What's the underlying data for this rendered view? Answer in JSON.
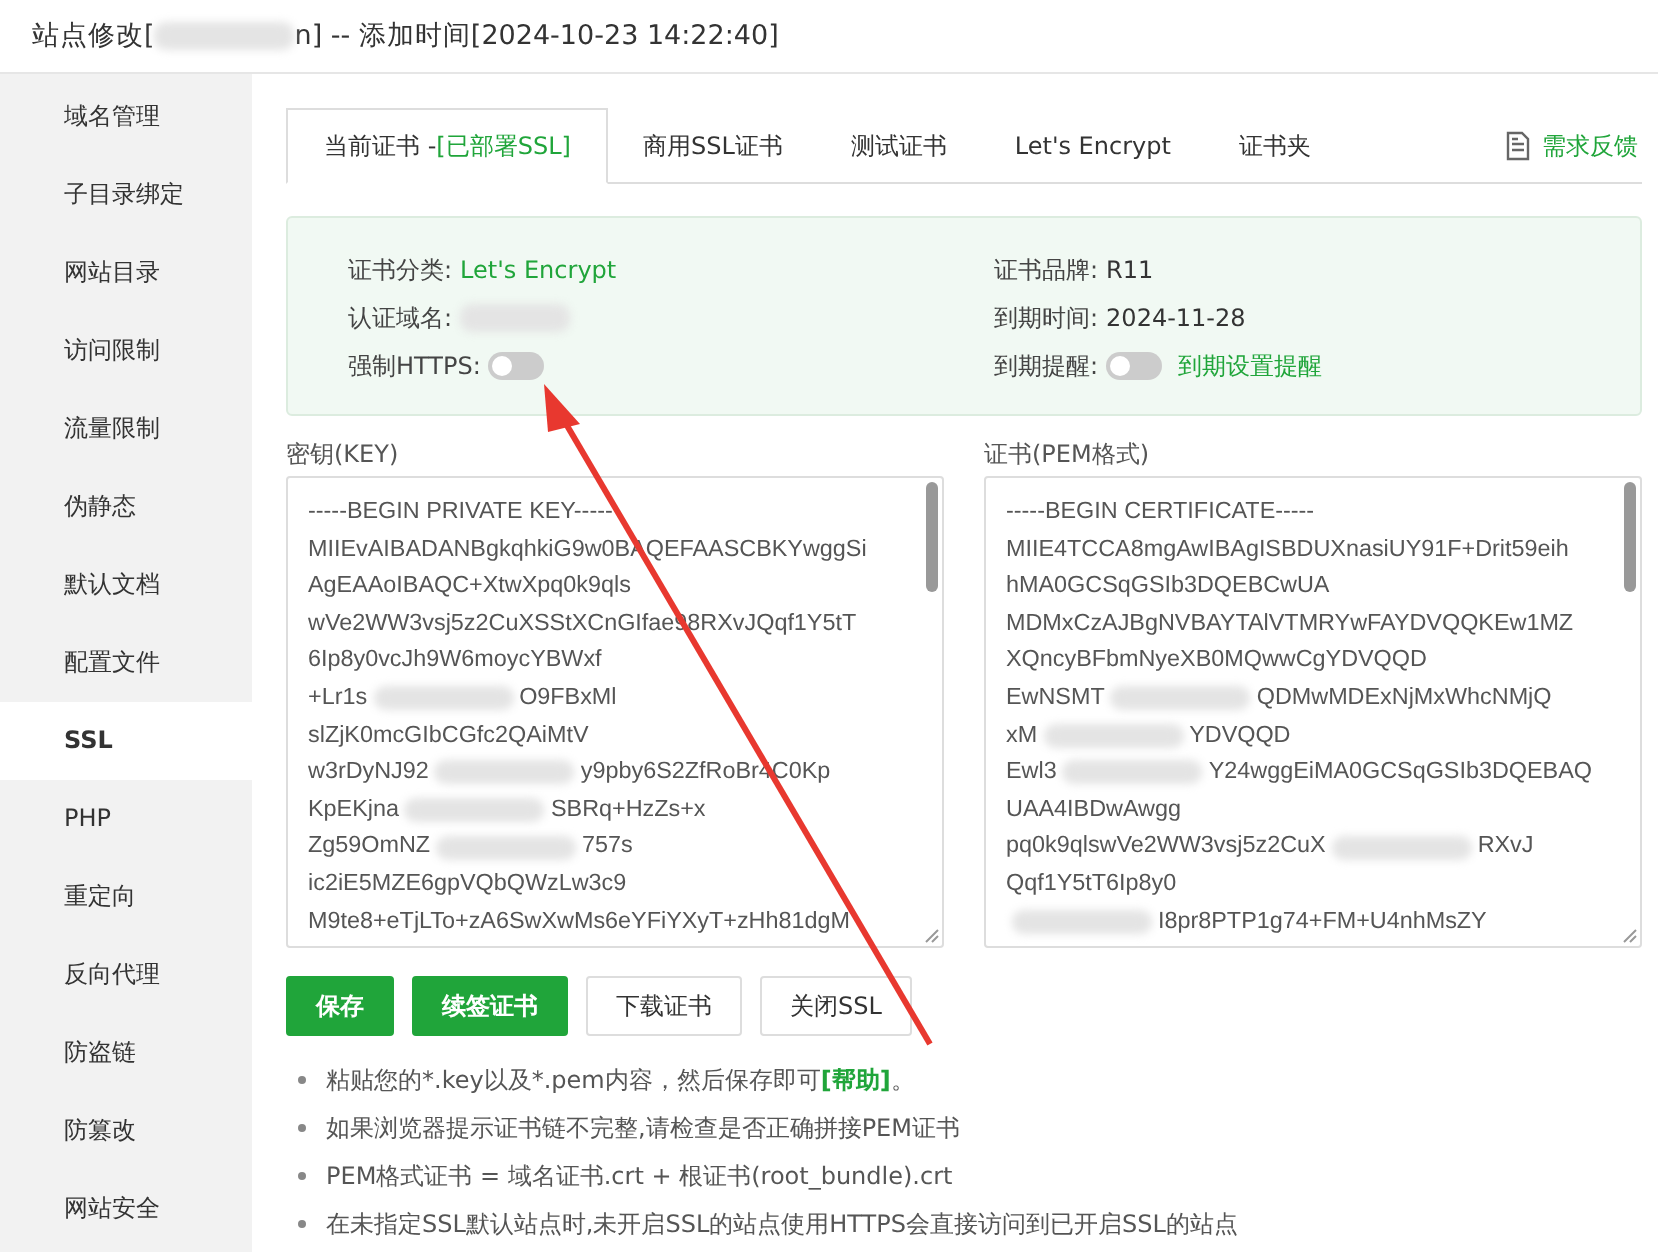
{
  "window": {
    "title_prefix": "站点修改[",
    "title_suffix": "n] -- 添加时间[2024-10-23 14:22:40]"
  },
  "sidebar": {
    "items": [
      {
        "label": "域名管理",
        "selected": false
      },
      {
        "label": "子目录绑定",
        "selected": false
      },
      {
        "label": "网站目录",
        "selected": false
      },
      {
        "label": "访问限制",
        "selected": false
      },
      {
        "label": "流量限制",
        "selected": false
      },
      {
        "label": "伪静态",
        "selected": false
      },
      {
        "label": "默认文档",
        "selected": false
      },
      {
        "label": "配置文件",
        "selected": false
      },
      {
        "label": "SSL",
        "selected": true
      },
      {
        "label": "PHP",
        "selected": false
      },
      {
        "label": "重定向",
        "selected": false
      },
      {
        "label": "反向代理",
        "selected": false
      },
      {
        "label": "防盗链",
        "selected": false
      },
      {
        "label": "防篡改",
        "selected": false
      },
      {
        "label": "网站安全",
        "selected": false
      }
    ]
  },
  "tabs": [
    {
      "label": "当前证书 -",
      "status": "[已部署SSL]",
      "selected": true
    },
    {
      "label": "商用SSL证书",
      "selected": false
    },
    {
      "label": "测试证书",
      "selected": false
    },
    {
      "label": "Let's Encrypt",
      "selected": false
    },
    {
      "label": "证书夹",
      "selected": false
    }
  ],
  "feedback_link": "需求反馈",
  "info": {
    "left": [
      {
        "label": "证书分类:",
        "value": "Let's Encrypt",
        "kind": "link"
      },
      {
        "label": "认证域名:",
        "kind": "blurred"
      },
      {
        "label": "强制HTTPS:",
        "kind": "toggle",
        "on": false
      }
    ],
    "right": [
      {
        "label": "证书品牌:",
        "value": "R11",
        "kind": "text"
      },
      {
        "label": "到期时间:",
        "value": "2024-11-28",
        "kind": "text"
      },
      {
        "label": "到期提醒:",
        "kind": "toggle",
        "on": false,
        "value": "到期设置提醒"
      }
    ]
  },
  "key_panel": {
    "label": "密钥(KEY)",
    "lines": [
      {
        "parts": [
          "-----BEGIN PRIVATE KEY-----"
        ]
      },
      {
        "parts": [
          "MIIEvAIBADANBgkqhkiG9w0BAQEFAASCBKYwggSi"
        ]
      },
      {
        "parts": [
          "AgEAAoIBAQC+XtwXpq0k9qls"
        ]
      },
      {
        "parts": [
          "wVe2WW3vsj5z2CuXSStXCnGIfae98RXvJQqf1Y5tT"
        ]
      },
      {
        "parts": [
          "6Ip8y0vcJh9W6moycYBWxf"
        ]
      },
      {
        "parts": [
          "+Lr1s",
          "O9FBxMl"
        ]
      },
      {
        "parts": [
          "slZjK0mcGIbCGfc2QAiMtV"
        ]
      },
      {
        "parts": [
          "w3rDyNJ92",
          "y9pby6S2ZfRoBr4C0Kp"
        ]
      },
      {
        "parts": [
          "KpEKjna",
          "SBRq+HzZs+x"
        ]
      },
      {
        "parts": [
          "Zg59OmNZ",
          "757s"
        ]
      },
      {
        "parts": [
          "ic2iE5MZE6gpVQbQWzLw3c9"
        ]
      },
      {
        "parts": [
          "M9te8+eTjLTo+zA6SwXwMs6eYFiYXyT+zHh81dgM"
        ]
      }
    ]
  },
  "cert_panel": {
    "label": "证书(PEM格式)",
    "lines": [
      {
        "parts": [
          "-----BEGIN CERTIFICATE-----"
        ]
      },
      {
        "parts": [
          "MIIE4TCCA8mgAwIBAgISBDUXnasiUY91F+Drit59eih"
        ]
      },
      {
        "parts": [
          "hMA0GCSqGSIb3DQEBCwUA"
        ]
      },
      {
        "parts": [
          "MDMxCzAJBgNVBAYTAlVTMRYwFAYDVQQKEw1MZ"
        ]
      },
      {
        "parts": [
          "XQncyBFbmNyeXB0MQwwCgYDVQQD"
        ]
      },
      {
        "parts": [
          "EwNSMT",
          "QDMwMDExNjMxWhcNMjQ"
        ]
      },
      {
        "parts": [
          "xM",
          "YDVQQD"
        ]
      },
      {
        "parts": [
          "Ewl3",
          "Y24wggEiMA0GCSqGSIb3DQEBAQ"
        ]
      },
      {
        "parts": [
          "UAA4IBDwAwgg"
        ]
      },
      {
        "parts": [
          "pq0k9qlswVe2WW3vsj5z2CuX",
          "RXvJ"
        ]
      },
      {
        "parts": [
          "Qqf1Y5tT6Ip8y0"
        ]
      },
      {
        "parts": [
          "I8pr8PTP1g74+FM+U4nhMsZY"
        ],
        "blur_before": true
      }
    ]
  },
  "buttons": [
    {
      "label": "保存",
      "kind": "primary"
    },
    {
      "label": "续签证书",
      "kind": "primary"
    },
    {
      "label": "下载证书",
      "kind": "default"
    },
    {
      "label": "关闭SSL",
      "kind": "default"
    }
  ],
  "notes": [
    {
      "text": "粘贴您的*.key以及*.pem内容，然后保存即可",
      "link": "[帮助]",
      "tail": "。"
    },
    {
      "text": "如果浏览器提示证书链不完整,请检查是否正确拼接PEM证书"
    },
    {
      "text": "PEM格式证书 = 域名证书.crt + 根证书(root_bundle).crt"
    },
    {
      "text": "在未指定SSL默认站点时,未开启SSL的站点使用HTTPS会直接访问到已开启SSL的站点"
    }
  ]
}
